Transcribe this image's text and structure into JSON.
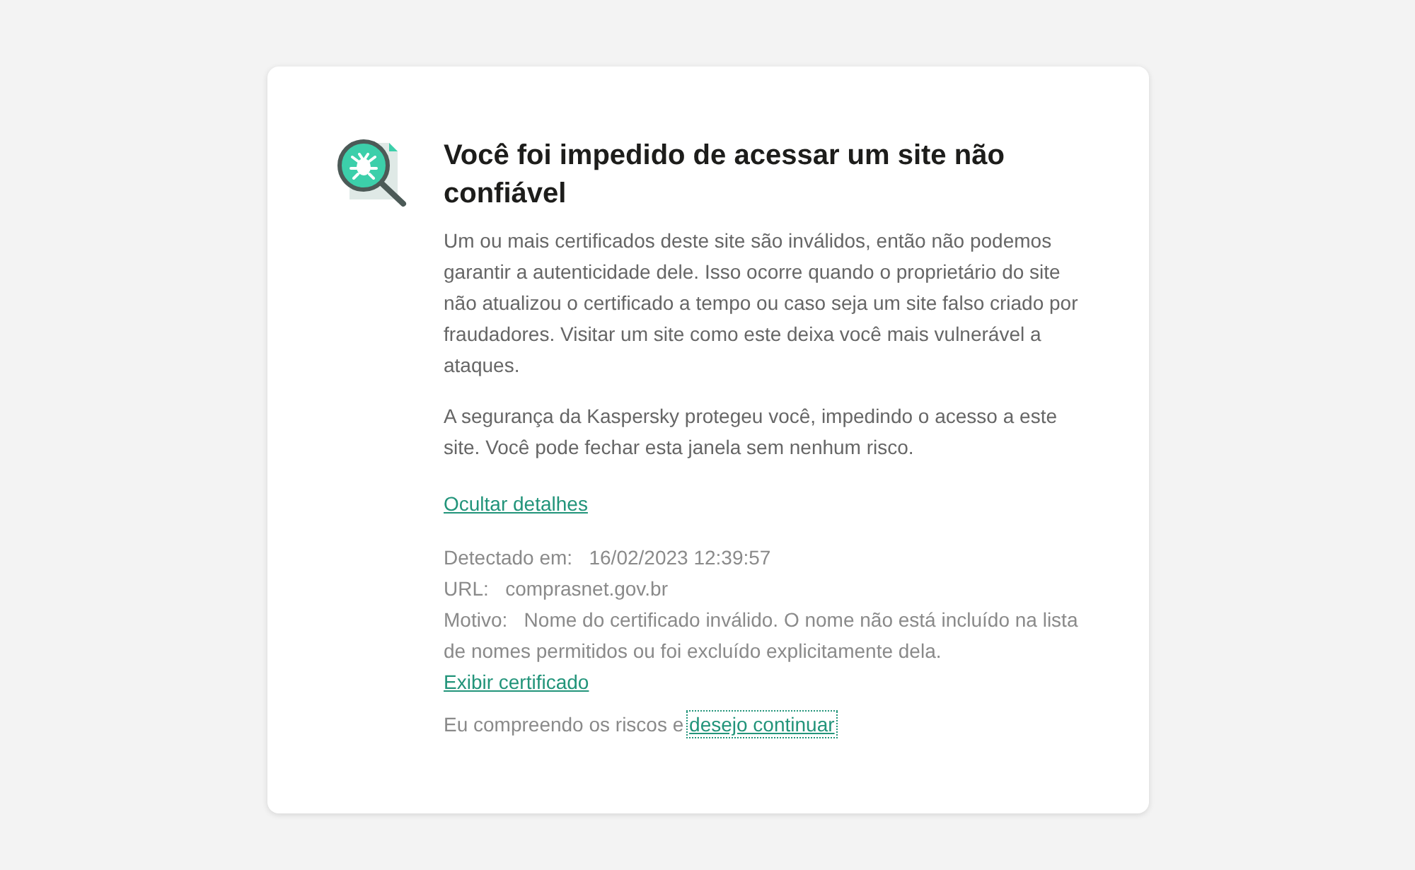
{
  "title": "Você foi impedido de acessar um site não confiável",
  "paragraphs": [
    "Um ou mais certificados deste site são inválidos, então não podemos garantir a autenticidade dele. Isso ocorre quando o proprietário do site não atualizou o certificado a tempo ou caso seja um site falso criado por fraudadores. Visitar um site como este deixa você mais vulnerável a ataques.",
    "A segurança da Kaspersky protegeu você, impedindo o acesso a este site. Você pode fechar esta janela sem nenhum risco."
  ],
  "details_toggle": {
    "label": "Ocultar detalhes"
  },
  "details": [
    {
      "label": "Detectado em:",
      "value": "16/02/2023 12:39:57"
    },
    {
      "label": "URL:",
      "value": "comprasnet.gov.br"
    },
    {
      "label": "Motivo:",
      "value": "Nome do certificado inválido. O nome não está incluído na lista de nomes permitidos ou foi excluído explicitamente dela.",
      "link": "Exibir certificado"
    }
  ],
  "proceed": {
    "text": "Eu compreendo os riscos e",
    "link": "desejo continuar",
    "focused": true
  }
}
